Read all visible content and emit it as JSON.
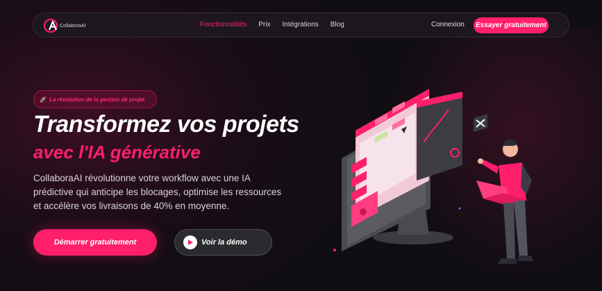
{
  "brand": {
    "name": "CollaboraAI",
    "accent": "#ff1f6b"
  },
  "nav": {
    "links": [
      "Fonctionnalités",
      "Prix",
      "Intégrations",
      "Blog"
    ],
    "active_index": 0,
    "login": "Connexion",
    "cta": "Essayer gratuitement"
  },
  "hero": {
    "badge_icon": "rocket-icon",
    "badge": "La révolution de la gestion de projet",
    "title": "Transformez vos projets",
    "subtitle": "avec l'IA générative",
    "description": "CollaboraAI révolutionne votre workflow avec une IA prédictive qui anticipe les blocages, optimise les ressources et accélère vos livraisons de 40% en moyenne.",
    "primary_button": "Démarrer gratuitement",
    "secondary_button": "Voir la démo",
    "secondary_icon": "play-icon"
  },
  "illustration": "person-with-laptop-and-dashboard-screen"
}
